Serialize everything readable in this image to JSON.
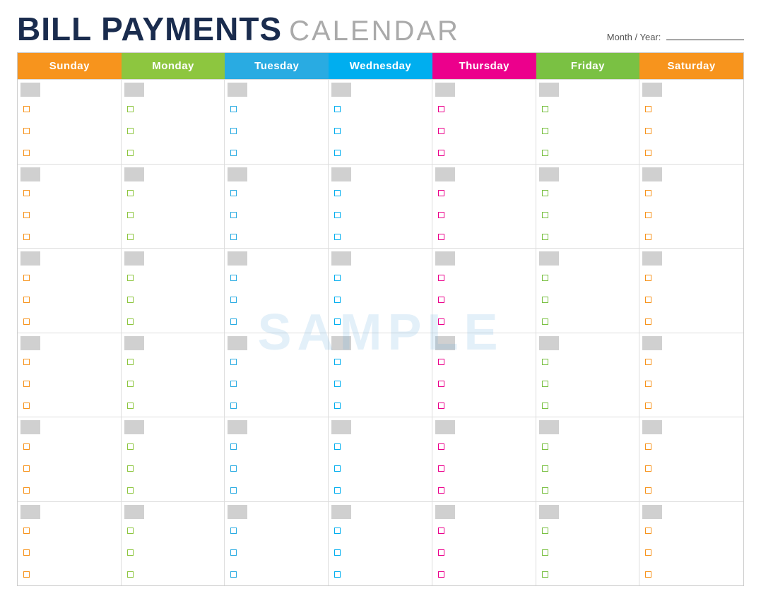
{
  "header": {
    "title_bold": "BILL PAYMENTS",
    "title_light": "CALENDAR",
    "month_year_label": "Month / Year:"
  },
  "days": [
    {
      "label": "Sunday",
      "class": "sunday",
      "col": 0
    },
    {
      "label": "Monday",
      "class": "monday",
      "col": 1
    },
    {
      "label": "Tuesday",
      "class": "tuesday",
      "col": 2
    },
    {
      "label": "Wednesday",
      "class": "wednesday",
      "col": 3
    },
    {
      "label": "Thursday",
      "class": "thursday",
      "col": 4
    },
    {
      "label": "Friday",
      "class": "friday",
      "col": 5
    },
    {
      "label": "Saturday",
      "class": "saturday",
      "col": 6
    }
  ],
  "weeks": 6,
  "checkboxes_per_cell": 3,
  "watermark": "SAMPLE"
}
